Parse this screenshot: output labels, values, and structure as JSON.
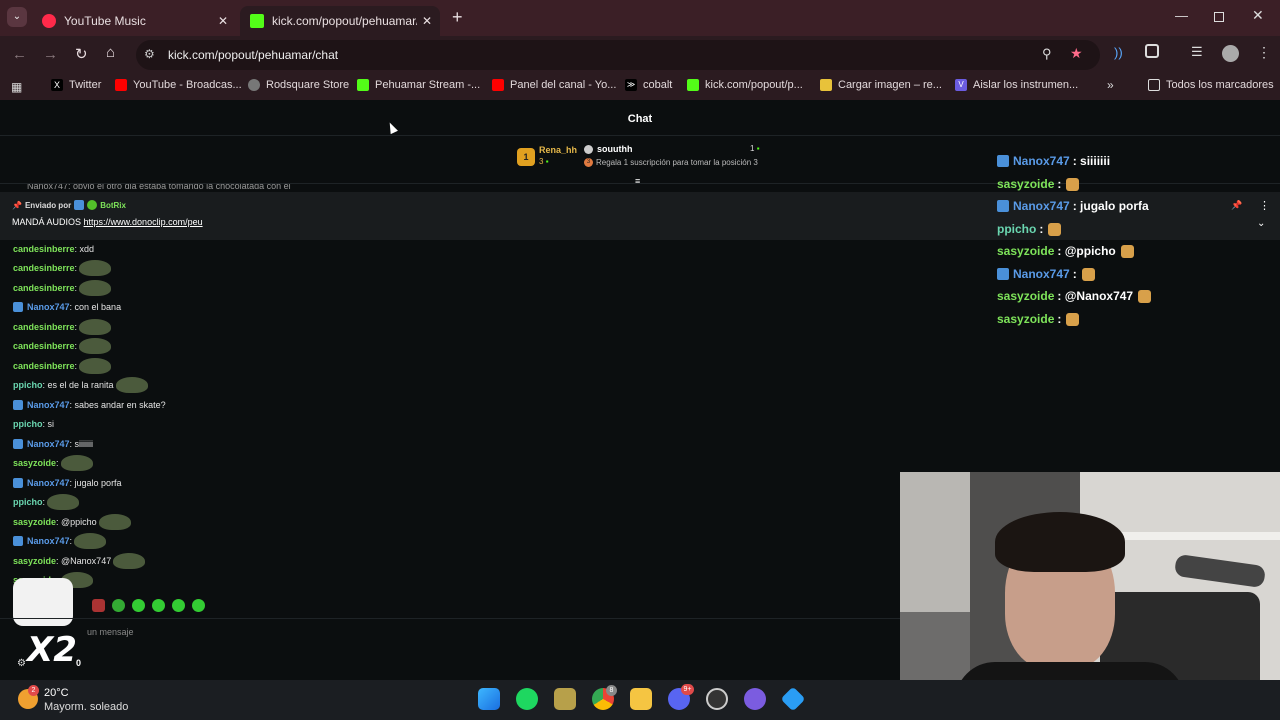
{
  "browser": {
    "tabs": [
      {
        "title": "YouTube Music",
        "active": false
      },
      {
        "title": "kick.com/popout/pehuamar/ch",
        "active": true
      }
    ],
    "address": "kick.com/popout/pehuamar/chat",
    "bookmarks": [
      {
        "label": "Twitter",
        "icon": "x-icon"
      },
      {
        "label": "YouTube - Broadcas...",
        "icon": "youtube-icon"
      },
      {
        "label": "Rodsquare Store",
        "icon": "store-icon"
      },
      {
        "label": "Pehuamar Stream -...",
        "icon": "kick-icon"
      },
      {
        "label": "Panel del canal - Yo...",
        "icon": "youtube-icon"
      },
      {
        "label": "cobalt",
        "icon": "cobalt-icon"
      },
      {
        "label": "kick.com/popout/p...",
        "icon": "kick-icon"
      },
      {
        "label": "Cargar imagen – re...",
        "icon": "image-icon"
      },
      {
        "label": "Aislar los instrumen...",
        "icon": "vocal-icon"
      }
    ],
    "all_bookmarks_label": "Todos los marcadores"
  },
  "chat": {
    "header_title": "Chat",
    "leaderboard": {
      "first_user": "Rena_hh",
      "first_rank": "1",
      "first_count": "3",
      "second_user": "souuthh",
      "second_count": "1",
      "cta_rank": "3",
      "cta_text": "Regala 1 suscripción para tomar la posición 3"
    },
    "truncated_line": "Nanox747: obvio el otro dia estaba tomando la chocolatada con el",
    "pinned": {
      "sent_by_label": "Enviado por",
      "bot_name": "BotRix",
      "message_prefix": "MANDÁ AUDIOS",
      "link": "https://www.donoclip.com/peu"
    },
    "messages": [
      {
        "user": "candesinberre",
        "text": ": xdd",
        "color": "#7ee35a",
        "badge": false,
        "emote": false
      },
      {
        "user": "candesinberre",
        "text": ":",
        "color": "#7ee35a",
        "badge": false,
        "emote": true
      },
      {
        "user": "candesinberre",
        "text": ":",
        "color": "#7ee35a",
        "badge": false,
        "emote": true
      },
      {
        "user": "Nanox747",
        "text": ": con el bana",
        "color": "#5a9be8",
        "badge": true,
        "emote": false
      },
      {
        "user": "candesinberre",
        "text": ":",
        "color": "#7ee35a",
        "badge": false,
        "emote": true
      },
      {
        "user": "candesinberre",
        "text": ":",
        "color": "#7ee35a",
        "badge": false,
        "emote": true
      },
      {
        "user": "candesinberre",
        "text": ":",
        "color": "#7ee35a",
        "badge": false,
        "emote": true
      },
      {
        "user": "ppicho",
        "text": ": es el de la ranita",
        "color": "#6ad6b0",
        "badge": false,
        "emote": true
      },
      {
        "user": "Nanox747",
        "text": ": sabes andar en skate?",
        "color": "#5a9be8",
        "badge": true,
        "emote": false
      },
      {
        "user": "ppicho",
        "text": ": si",
        "color": "#6ad6b0",
        "badge": false,
        "emote": false
      },
      {
        "user": "Nanox747",
        "text": ": siiiiiii",
        "color": "#5a9be8",
        "badge": true,
        "emote": false
      },
      {
        "user": "sasyzoide",
        "text": ":",
        "color": "#7ee35a",
        "badge": false,
        "emote": true
      },
      {
        "user": "Nanox747",
        "text": ": jugalo porfa",
        "color": "#5a9be8",
        "badge": true,
        "emote": false
      },
      {
        "user": "ppicho",
        "text": ":",
        "color": "#6ad6b0",
        "badge": false,
        "emote": true
      },
      {
        "user": "sasyzoide",
        "text": ": @ppicho",
        "color": "#7ee35a",
        "badge": false,
        "emote": true
      },
      {
        "user": "Nanox747",
        "text": ":",
        "color": "#5a9be8",
        "badge": true,
        "emote": true
      },
      {
        "user": "sasyzoide",
        "text": ": @Nanox747",
        "color": "#7ee35a",
        "badge": false,
        "emote": true
      },
      {
        "user": "sasyzoide",
        "text": ":",
        "color": "#7ee35a",
        "badge": false,
        "emote": true
      }
    ],
    "input_placeholder": "un mensaje",
    "counter": "0",
    "overlay_x2": "X2"
  },
  "overlay": {
    "messages": [
      {
        "user": "Nanox747",
        "text": ": siiiiiii",
        "color": "#5a9be8",
        "badge": true,
        "emote": false
      },
      {
        "user": "sasyzoide",
        "text": ":",
        "color": "#7ee35a",
        "badge": false,
        "emote": true
      },
      {
        "user": "Nanox747",
        "text": ": jugalo porfa",
        "color": "#5a9be8",
        "badge": true,
        "emote": false
      },
      {
        "user": "ppicho",
        "text": ":",
        "color": "#6ad6b0",
        "badge": false,
        "emote": true
      },
      {
        "user": "sasyzoide",
        "text": ": @ppicho",
        "color": "#7ee35a",
        "badge": false,
        "emote": true
      },
      {
        "user": "Nanox747",
        "text": ":",
        "color": "#5a9be8",
        "badge": true,
        "emote": true
      },
      {
        "user": "sasyzoide",
        "text": ": @Nanox747",
        "color": "#7ee35a",
        "badge": false,
        "emote": true
      },
      {
        "user": "sasyzoide",
        "text": ":",
        "color": "#7ee35a",
        "badge": false,
        "emote": true
      }
    ]
  },
  "taskbar": {
    "temperature": "20°C",
    "weather": "Mayorm. soleado",
    "weather_badge": "2",
    "chrome_badge": "8",
    "discord_badge": "9+"
  }
}
